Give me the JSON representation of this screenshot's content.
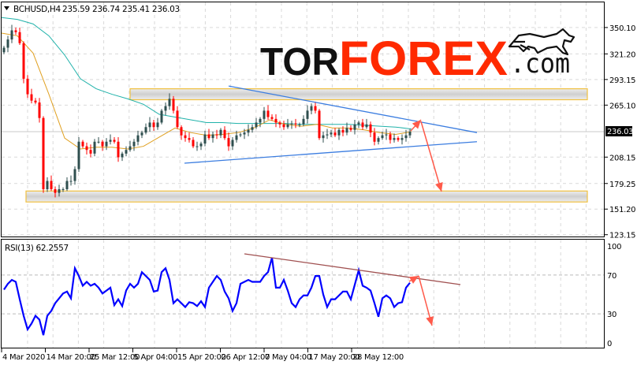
{
  "header": {
    "symbol": "BCHUSD,H4",
    "ohlc": "235.59 236.74 235.41 236.03"
  },
  "logo": {
    "text_dark": "TOR",
    "text_red": "FOREX",
    "suffix": ".com",
    "icon": "bull-icon"
  },
  "colors": {
    "bull": "#2f4f4f",
    "bear": "#ff0000",
    "ma_fast": "#e0a020",
    "ma_slow": "#20b2aa",
    "trendline": "#3b7de0",
    "arrow": "#ff5a4a",
    "rsi": "#0000ff",
    "rsi_trendline": "#a05050",
    "zone_border": "#f0c040",
    "zone_fill": "#d8d8d8",
    "grid": "#d9d9d9"
  },
  "chart_data": [
    {
      "type": "candlestick",
      "title": "BCHUSD,H4",
      "current_price": "236.03",
      "y_ticks": [
        "350.10",
        "321.20",
        "293.15",
        "265.10",
        "208.15",
        "179.25",
        "151.20",
        "123.15"
      ],
      "ylim": [
        123.15,
        370
      ],
      "x_ticks": [
        "4 Mar 2020",
        "14 Mar 20:00",
        "25 Mar 12:00",
        "5 Apr 04:00",
        "15 Apr 20:00",
        "26 Apr 12:00",
        "7 May 04:00",
        "17 May 20:00",
        "28 May 12:00"
      ],
      "grid": true,
      "close": [
        328,
        337,
        347,
        345,
        333,
        294,
        277,
        270,
        268,
        251,
        173,
        182,
        173,
        169,
        173,
        173,
        182,
        182,
        195,
        225,
        220,
        216,
        212,
        225,
        225,
        220,
        225,
        227,
        225,
        208,
        212,
        216,
        220,
        225,
        232,
        235,
        241,
        246,
        241,
        246,
        259,
        264,
        272,
        259,
        241,
        232,
        229,
        227,
        220,
        220,
        223,
        233,
        229,
        233,
        232,
        238,
        229,
        220,
        227,
        232,
        233,
        235,
        238,
        241,
        246,
        250,
        259,
        252,
        250,
        246,
        244,
        241,
        244,
        245,
        244,
        244,
        250,
        259,
        264,
        259,
        229,
        232,
        233,
        235,
        232,
        238,
        235,
        240,
        238,
        244,
        246,
        241,
        244,
        235,
        225,
        229,
        232,
        233,
        227,
        229,
        227,
        229,
        232,
        236
      ],
      "ma_fast": [
        344,
        341,
        322,
        277,
        229,
        217,
        219,
        219,
        217,
        220,
        230,
        240,
        235,
        232,
        233,
        235,
        240,
        249,
        244,
        242,
        244,
        240,
        240,
        238,
        235,
        233,
        236
      ],
      "ma_slow": [
        361,
        359,
        354,
        341,
        320,
        294,
        283,
        277,
        272,
        266,
        255,
        252,
        249,
        246,
        246,
        245,
        245,
        245,
        245,
        244,
        244,
        244,
        244,
        243,
        242,
        241,
        239
      ],
      "zones": [
        [
          271,
          283
        ],
        [
          159,
          171
        ]
      ],
      "triangle": {
        "upper": [
          286,
          235
        ],
        "lower": [
          201.5,
          225
        ]
      }
    },
    {
      "type": "line",
      "title": "RSI(13) 62.2557",
      "y_ticks": [
        "100",
        "70",
        "30",
        "0"
      ],
      "ylim": [
        0,
        100
      ],
      "levels": [
        70,
        30
      ],
      "values": [
        55,
        61,
        65,
        63,
        45,
        28,
        14,
        20,
        28,
        24,
        8,
        28,
        33,
        41,
        46,
        51,
        53,
        46,
        77,
        69,
        59,
        63,
        59,
        61,
        57,
        51,
        54,
        57,
        39,
        45,
        38,
        54,
        61,
        57,
        61,
        73,
        69,
        65,
        53,
        54,
        73,
        77,
        65,
        41,
        45,
        41,
        37,
        42,
        41,
        38,
        43,
        37,
        57,
        63,
        69,
        65,
        53,
        46,
        33,
        41,
        61,
        63,
        65,
        63,
        63,
        63,
        69,
        73,
        88,
        57,
        57,
        65,
        54,
        41,
        37,
        45,
        49,
        49,
        57,
        69,
        69,
        50,
        37,
        45,
        45,
        49,
        53,
        53,
        45,
        60,
        75,
        59,
        57,
        54,
        41,
        27,
        46,
        49,
        46,
        37,
        41,
        42,
        57,
        62
      ]
    }
  ]
}
